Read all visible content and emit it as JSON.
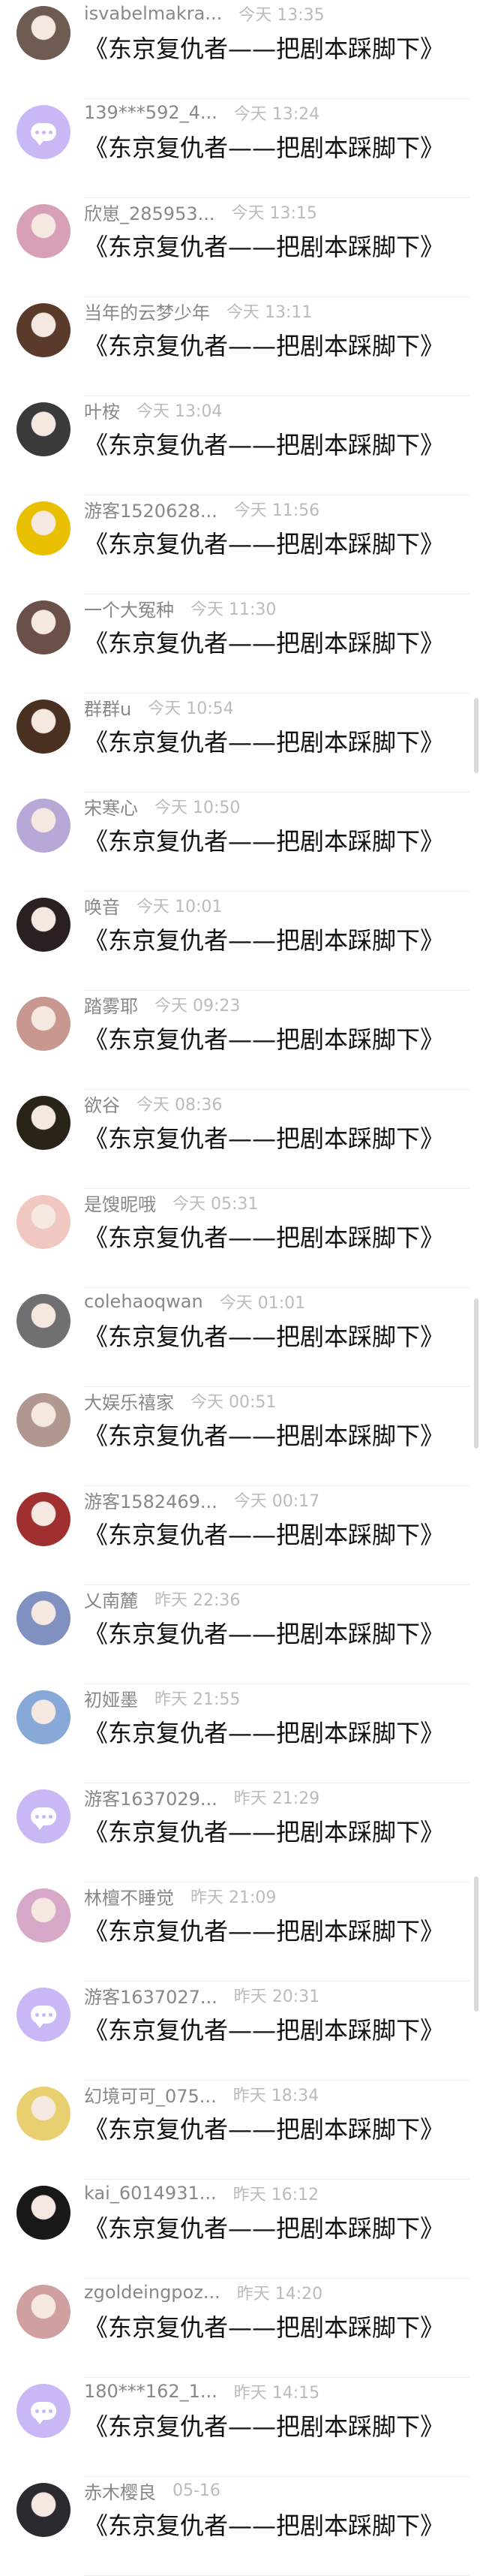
{
  "comments": [
    {
      "username": "isvabelmakra...",
      "time": "今天 13:35",
      "message": "《东京复仇者——把剧本踩脚下》",
      "avatar": "photo",
      "color": "#6e5b52"
    },
    {
      "username": "139***592_4...",
      "time": "今天 13:24",
      "message": "《东京复仇者——把剧本踩脚下》",
      "avatar": "default",
      "color": "#c9b8f5"
    },
    {
      "username": "欣崽_285953...",
      "time": "今天 13:15",
      "message": "《东京复仇者——把剧本踩脚下》",
      "avatar": "photo",
      "color": "#d8a0b8"
    },
    {
      "username": "当年的云梦少年",
      "time": "今天 13:11",
      "message": "《东京复仇者——把剧本踩脚下》",
      "avatar": "photo",
      "color": "#5a3a2a"
    },
    {
      "username": "叶桉",
      "time": "今天 13:04",
      "message": "《东京复仇者——把剧本踩脚下》",
      "avatar": "photo",
      "color": "#3a3a3a"
    },
    {
      "username": "游客1520628...",
      "time": "今天 11:56",
      "message": "《东京复仇者——把剧本踩脚下》",
      "avatar": "photo",
      "color": "#e8c000"
    },
    {
      "username": "一个大冤种",
      "time": "今天 11:30",
      "message": "《东京复仇者——把剧本踩脚下》",
      "avatar": "photo",
      "color": "#6a5048"
    },
    {
      "username": "群群u",
      "time": "今天 10:54",
      "message": "《东京复仇者——把剧本踩脚下》",
      "avatar": "photo",
      "color": "#4a3020"
    },
    {
      "username": "宋寒心",
      "time": "今天 10:50",
      "message": "《东京复仇者——把剧本踩脚下》",
      "avatar": "photo",
      "color": "#b8a8d8"
    },
    {
      "username": "唤音",
      "time": "今天 10:01",
      "message": "《东京复仇者——把剧本踩脚下》",
      "avatar": "photo",
      "color": "#2a2020"
    },
    {
      "username": "踏雾耶",
      "time": "今天 09:23",
      "message": "《东京复仇者——把剧本踩脚下》",
      "avatar": "photo",
      "color": "#c89890"
    },
    {
      "username": "欲谷",
      "time": "今天 08:36",
      "message": "《东京复仇者——把剧本踩脚下》",
      "avatar": "photo",
      "color": "#2a2418"
    },
    {
      "username": "是馊昵哦",
      "time": "今天 05:31",
      "message": "《东京复仇者——把剧本踩脚下》",
      "avatar": "photo",
      "color": "#f0c8c0"
    },
    {
      "username": "colehaoqwan",
      "time": "今天 01:01",
      "message": "《东京复仇者——把剧本踩脚下》",
      "avatar": "photo",
      "color": "#707070"
    },
    {
      "username": "大娱乐禧家",
      "time": "今天 00:51",
      "message": "《东京复仇者——把剧本踩脚下》",
      "avatar": "photo",
      "color": "#b09890"
    },
    {
      "username": "游客1582469...",
      "time": "今天 00:17",
      "message": "《东京复仇者——把剧本踩脚下》",
      "avatar": "photo",
      "color": "#a03030"
    },
    {
      "username": "乂南麓",
      "time": "昨天 22:36",
      "message": "《东京复仇者——把剧本踩脚下》",
      "avatar": "photo",
      "color": "#8090c0"
    },
    {
      "username": "初娅墨",
      "time": "昨天 21:55",
      "message": "《东京复仇者——把剧本踩脚下》",
      "avatar": "photo",
      "color": "#88a8d8"
    },
    {
      "username": "游客1637029...",
      "time": "昨天 21:29",
      "message": "《东京复仇者——把剧本踩脚下》",
      "avatar": "default",
      "color": "#c9b8f5"
    },
    {
      "username": "林檀不睡觉",
      "time": "昨天 21:09",
      "message": "《东京复仇者——把剧本踩脚下》",
      "avatar": "photo",
      "color": "#d8a8c8"
    },
    {
      "username": "游客1637027...",
      "time": "昨天 20:31",
      "message": "《东京复仇者——把剧本踩脚下》",
      "avatar": "default",
      "color": "#c9b8f5"
    },
    {
      "username": "幻境可可_075...",
      "time": "昨天 18:34",
      "message": "《东京复仇者——把剧本踩脚下》",
      "avatar": "photo",
      "color": "#e8d070"
    },
    {
      "username": "kai_6014931...",
      "time": "昨天 16:12",
      "message": "《东京复仇者——把剧本踩脚下》",
      "avatar": "photo",
      "color": "#181818"
    },
    {
      "username": "zgoldeingpoz...",
      "time": "昨天 14:20",
      "message": "《东京复仇者——把剧本踩脚下》",
      "avatar": "photo",
      "color": "#d0a0a0"
    },
    {
      "username": "180***162_1...",
      "time": "昨天 14:15",
      "message": "《东京复仇者——把剧本踩脚下》",
      "avatar": "default",
      "color": "#c9b8f5"
    },
    {
      "username": "赤木樱良",
      "time": "05-16",
      "message": "《东京复仇者——把剧本踩脚下》",
      "avatar": "photo",
      "color": "#2a2a30"
    }
  ]
}
